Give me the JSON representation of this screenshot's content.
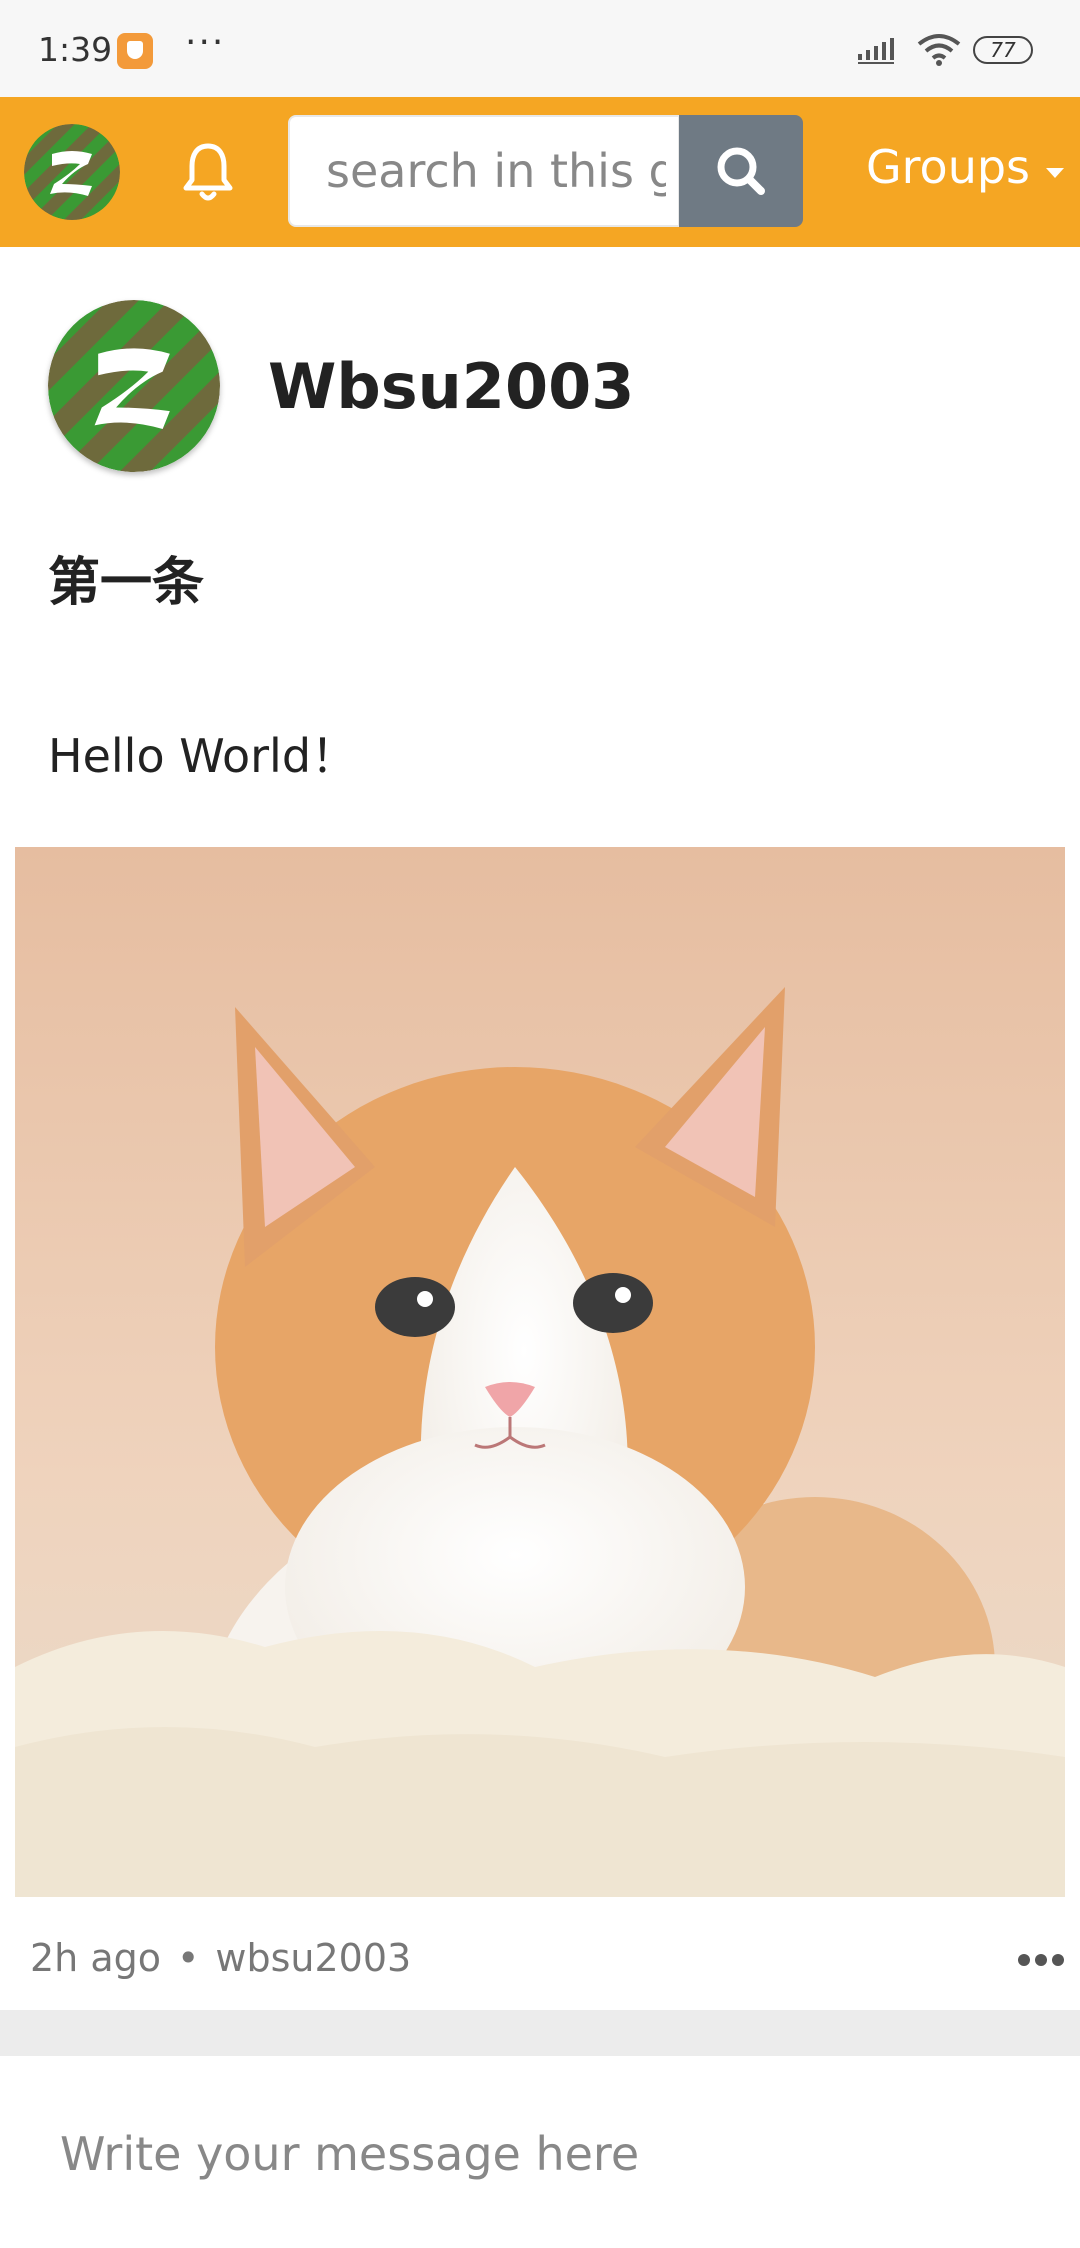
{
  "status_bar": {
    "time": "1:39",
    "dots": "···",
    "battery": "77",
    "app_icon": "shield-icon",
    "signal_icon": "signal-icon",
    "wifi_icon": "wifi-icon"
  },
  "header": {
    "logo_icon": "app-logo-icon",
    "notification_icon": "bell-icon",
    "search": {
      "value": "",
      "placeholder": "search in this g"
    },
    "search_button_icon": "search-icon",
    "groups_label": "Groups",
    "groups_caret_icon": "caret-down-icon",
    "accent_color": "#f5a623"
  },
  "post": {
    "author": "Wbsu2003",
    "title": "第一条",
    "body": "Hello World！",
    "image": "kitten-photo",
    "time_ago": "2h ago",
    "separator": "•",
    "username": "wbsu2003",
    "more_icon": "more-options-icon"
  },
  "composer": {
    "value": "",
    "placeholder": "Write your message here"
  }
}
